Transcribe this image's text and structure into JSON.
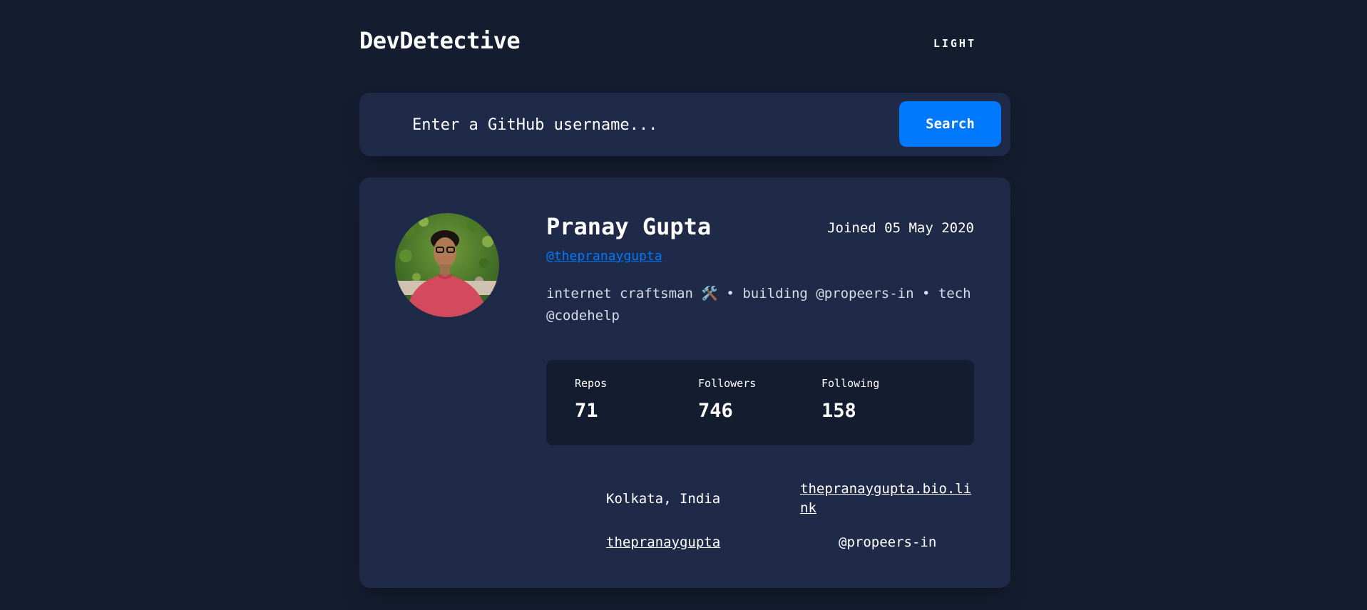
{
  "app": {
    "logo": "DevDetective",
    "theme_toggle_label": "LIGHT"
  },
  "search": {
    "placeholder": "Enter a GitHub username...",
    "value": "",
    "button_label": "Search"
  },
  "profile": {
    "name": "Pranay Gupta",
    "joined": "Joined 05 May 2020",
    "username": "@thepranaygupta",
    "bio": "internet craftsman 🛠️ • building @propeers-in • tech @codehelp",
    "stats": {
      "repos_label": "Repos",
      "repos_value": "71",
      "followers_label": "Followers",
      "followers_value": "746",
      "following_label": "Following",
      "following_value": "158"
    },
    "links": {
      "location": "Kolkata, India",
      "website_line1": "thepranaygupta.bio.li",
      "website_line2": "nk",
      "twitter": "thepranaygupta",
      "company": "@propeers-in"
    }
  },
  "colors": {
    "background": "#141c2f",
    "card": "#1e2a47",
    "stats_panel": "#141d2f",
    "accent": "#0079ff",
    "text": "#ffffff"
  },
  "icons": {
    "theme": "sun-icon",
    "search": "search-icon",
    "location": "location-pin-icon",
    "website": "link-icon",
    "twitter": "twitter-icon",
    "company": "building-icon"
  }
}
